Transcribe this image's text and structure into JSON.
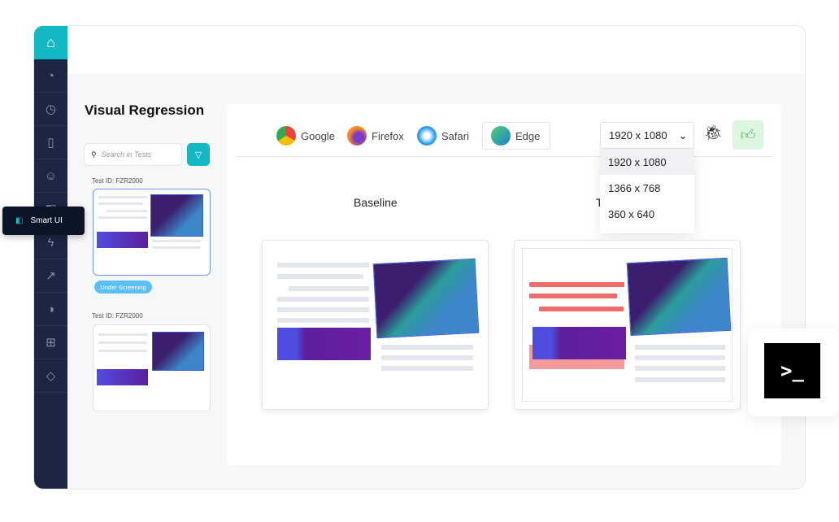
{
  "app": {
    "title": "Visual Regression",
    "tooltip": "Smart UI"
  },
  "sidebar": {
    "items": [
      "logo-icon",
      "speedometer-icon",
      "clock-icon",
      "mobile-icon",
      "robot-icon",
      "smart-ui-icon",
      "lightning-icon",
      "analytics-icon",
      "toggle-icon",
      "plus-icon",
      "shapes-icon"
    ]
  },
  "search": {
    "placeholder": "Search in Tests"
  },
  "tests": [
    {
      "id": "Test ID: FZR2000",
      "status": "Under Screening"
    },
    {
      "id": "Test ID: FZR2000"
    }
  ],
  "browsers": [
    "Google",
    "Firefox",
    "Safari",
    "Edge"
  ],
  "resolution": {
    "selected": "1920 x 1080",
    "options": [
      "1920 x 1080",
      "1366 x 768",
      "360 x 640"
    ]
  },
  "compare": {
    "baseline": "Baseline",
    "test": "T"
  },
  "colors": {
    "accent": "#14b8c4",
    "sidebar": "#1c2541",
    "approve": "#4cbc5c",
    "diff": "#f26b6b"
  },
  "terminal": {
    "glyph": ">_"
  }
}
